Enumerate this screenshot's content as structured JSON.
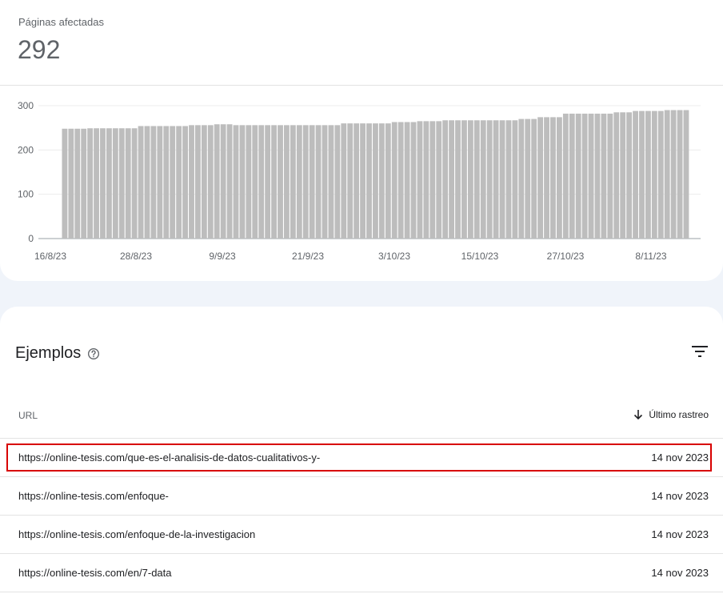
{
  "metric": {
    "label": "Páginas afectadas",
    "value": "292"
  },
  "chart_data": {
    "type": "bar",
    "title": "",
    "xlabel": "",
    "ylabel": "",
    "ylim": [
      0,
      300
    ],
    "yticks": [
      "300",
      "200",
      "100",
      "0"
    ],
    "xtick_labels": [
      "16/8/23",
      "28/8/23",
      "9/9/23",
      "21/9/23",
      "3/10/23",
      "15/10/23",
      "27/10/23",
      "8/11/23"
    ],
    "grid": true,
    "bar_color": "#bdbdbd",
    "series": [
      {
        "values": [
          248,
          248,
          248,
          248,
          249,
          249,
          249,
          249,
          249,
          249,
          249,
          249,
          254,
          254,
          254,
          254,
          254,
          254,
          254,
          254,
          256,
          256,
          256,
          256,
          258,
          258,
          258,
          256,
          256,
          256,
          256,
          256,
          256,
          256,
          256,
          256,
          256,
          256,
          256,
          256,
          256,
          256,
          256,
          256,
          260,
          260,
          260,
          260,
          260,
          260,
          260,
          260,
          263,
          263,
          263,
          263,
          265,
          265,
          265,
          265,
          267,
          267,
          267,
          267,
          267,
          267,
          267,
          267,
          267,
          267,
          267,
          267,
          270,
          270,
          270,
          274,
          274,
          274,
          274,
          282,
          282,
          282,
          282,
          282,
          282,
          282,
          282,
          285,
          285,
          285,
          288,
          288,
          288,
          288,
          288,
          290,
          290,
          290,
          290
        ]
      }
    ]
  },
  "examples": {
    "title": "Ejemplos",
    "help_icon": "help-circle-icon",
    "filter_icon": "filter-list-icon",
    "columns": {
      "url": "URL",
      "date": "Último rastreo"
    },
    "rows": [
      {
        "url": "https://online-tesis.com/que-es-el-analisis-de-datos-cualitativos-y-",
        "date": "14 nov 2023"
      },
      {
        "url": "https://online-tesis.com/enfoque-",
        "date": "14 nov 2023"
      },
      {
        "url": "https://online-tesis.com/enfoque-de-la-investigacion",
        "date": "14 nov 2023"
      },
      {
        "url": "https://online-tesis.com/en/7-data",
        "date": "14 nov 2023"
      }
    ]
  },
  "colors": {
    "highlight_border": "#d80000",
    "bar": "#bdbdbd"
  }
}
